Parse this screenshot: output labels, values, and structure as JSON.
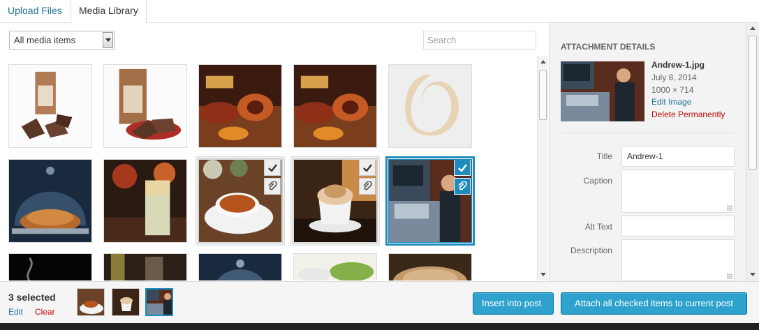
{
  "tabs": [
    {
      "label": "Upload Files"
    },
    {
      "label": "Media Library"
    }
  ],
  "toolbar": {
    "filter_value": "All media items",
    "search_placeholder": "Search"
  },
  "sidebar": {
    "heading": "ATTACHMENT DETAILS",
    "filename": "Andrew-1.jpg",
    "date": "July 8, 2014",
    "dimensions": "1000 × 714",
    "edit_image": "Edit Image",
    "delete": "Delete Permanently",
    "fields": {
      "title_label": "Title",
      "title_value": "Andrew-1",
      "caption_label": "Caption",
      "alt_label": "Alt Text",
      "description_label": "Description"
    }
  },
  "footer": {
    "selected_count": "3 selected",
    "edit": "Edit",
    "clear": "Clear",
    "insert_button": "Insert into post",
    "attach_button": "Attach all checked items to current post"
  },
  "colors": {
    "accent": "#2ea2cc",
    "link": "#21759b",
    "danger": "#bc0b0b",
    "selected_border": "#1e8cbe"
  }
}
